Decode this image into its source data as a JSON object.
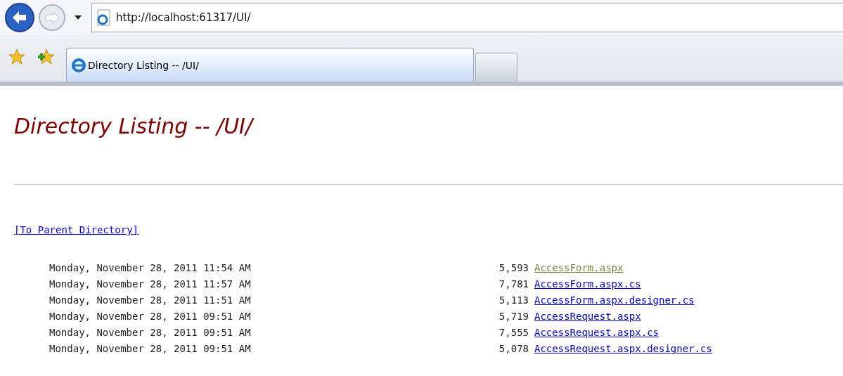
{
  "browser": {
    "address": "http://localhost:61317/UI/",
    "tabs": [
      {
        "title": "Directory Listing -- /UI/",
        "selected": true
      }
    ]
  },
  "page": {
    "heading": "Directory Listing -- /UI/",
    "parent_link": "[To Parent Directory]",
    "files": [
      {
        "date": "Monday, November 28, 2011 11:54 AM",
        "size": "5,593",
        "name": "AccessForm.aspx",
        "visited": true
      },
      {
        "date": "Monday, November 28, 2011 11:57 AM",
        "size": "7,781",
        "name": "AccessForm.aspx.cs",
        "visited": false
      },
      {
        "date": "Monday, November 28, 2011 11:51 AM",
        "size": "5,113",
        "name": "AccessForm.aspx.designer.cs",
        "visited": false
      },
      {
        "date": "Monday, November 28, 2011 09:51 AM",
        "size": "5,719",
        "name": "AccessRequest.aspx",
        "visited": false
      },
      {
        "date": "Monday, November 28, 2011 09:51 AM",
        "size": "7,555",
        "name": "AccessRequest.aspx.cs",
        "visited": false
      },
      {
        "date": "Monday, November 28, 2011 09:51 AM",
        "size": "5,078",
        "name": "AccessRequest.aspx.designer.cs",
        "visited": false
      }
    ]
  }
}
